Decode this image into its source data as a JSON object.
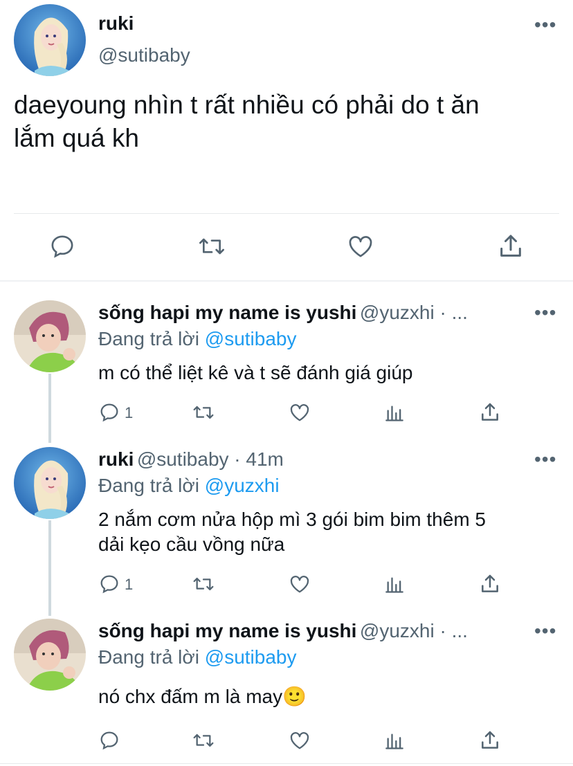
{
  "main_tweet": {
    "display_name": "ruki",
    "handle": "@sutibaby",
    "text_line1": "daeyoung nhìn t rất nhiều có phải do t ăn",
    "text_line2": "lắm quá kh",
    "actions": {
      "reply_icon": "comment-icon",
      "retweet_icon": "retweet-icon",
      "like_icon": "heart-icon",
      "share_icon": "share-icon"
    }
  },
  "replies": [
    {
      "display_name": "sống hapi my name is yushi",
      "handle_time": "@yuzxhi · ...",
      "replying_prefix": "Đang trả lời",
      "replying_to": "@sutibaby",
      "text_line1": "m có thể liệt kê và t sẽ đánh giá giúp",
      "text_line2": "",
      "reply_count": "1"
    },
    {
      "display_name": "ruki",
      "handle_time": "@sutibaby · 41m",
      "replying_prefix": "Đang trả lời",
      "replying_to": "@yuzxhi",
      "text_line1": "2 nắm cơm nửa hộp mì 3 gói bim bim thêm 5",
      "text_line2": "dải kẹo cầu vồng nữa",
      "reply_count": "1"
    },
    {
      "display_name": "sống hapi my name is yushi",
      "handle_time": "@yuzxhi · ...",
      "replying_prefix": "Đang trả lời",
      "replying_to": "@sutibaby",
      "text_line1": "nó chx đấm m là may🙂",
      "text_line2": "",
      "reply_count": ""
    }
  ],
  "colors": {
    "text": "#0f1419",
    "secondary": "#536471",
    "link": "#1d9bf0",
    "divider": "#e6e9eb"
  }
}
